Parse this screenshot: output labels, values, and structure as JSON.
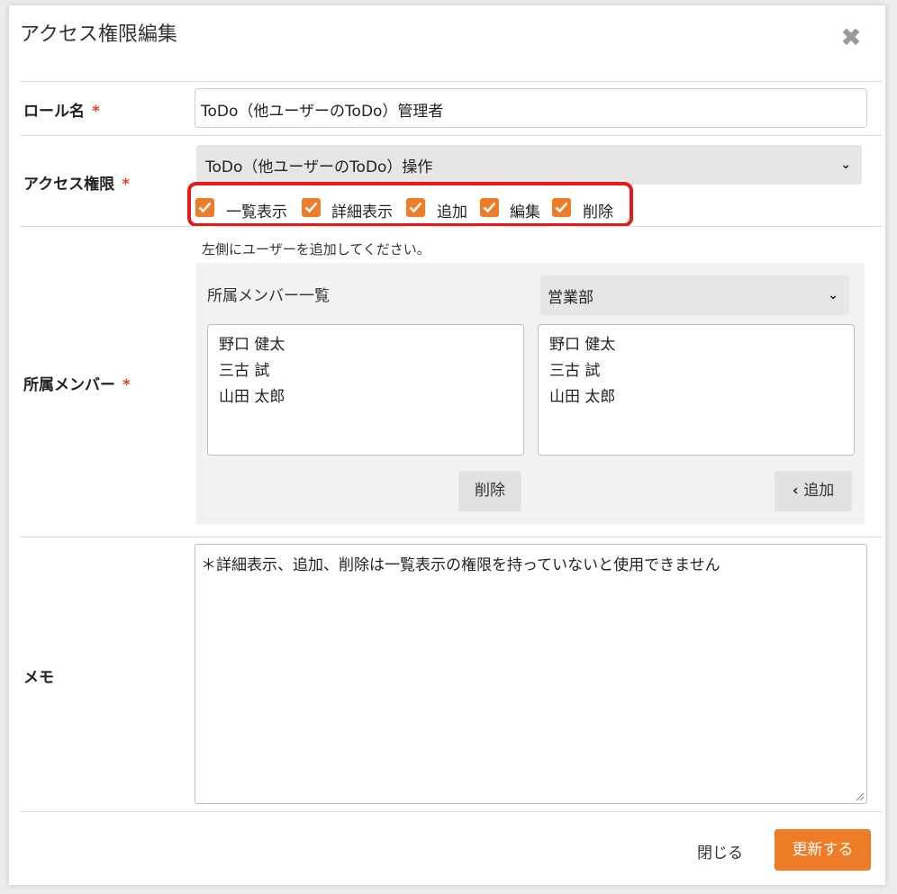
{
  "dialog": {
    "title": "アクセス権限編集",
    "close_glyph": "✖"
  },
  "role_name": {
    "label": "ロール名",
    "required_mark": "*",
    "value": "ToDo（他ユーザーのToDo）管理者"
  },
  "access": {
    "label": "アクセス権限",
    "required_mark": "*",
    "selected": "ToDo（他ユーザーのToDo）操作",
    "permissions": [
      {
        "label": "一覧表示",
        "checked": true
      },
      {
        "label": "詳細表示",
        "checked": true
      },
      {
        "label": "追加",
        "checked": true
      },
      {
        "label": "編集",
        "checked": true
      },
      {
        "label": "削除",
        "checked": true
      }
    ]
  },
  "members": {
    "label": "所属メンバー",
    "required_mark": "*",
    "help": "左側にユーザーを追加してください。",
    "list_title": "所属メンバー一覧",
    "department_selected": "営業部",
    "assigned": [
      "野口 健太",
      "三古 試",
      "山田 太郎"
    ],
    "available": [
      "野口 健太",
      "三古 試",
      "山田 太郎"
    ],
    "remove_label": "削除",
    "add_label": "追加",
    "add_icon": "‹"
  },
  "memo": {
    "label": "メモ",
    "value": "＊詳細表示、追加、削除は一覧表示の権限を持っていないと使用できません"
  },
  "footer": {
    "close_label": "閉じる",
    "submit_label": "更新する"
  },
  "colors": {
    "accent": "#ef7d27",
    "required": "#e0432b",
    "highlight": "#e31b1b"
  }
}
